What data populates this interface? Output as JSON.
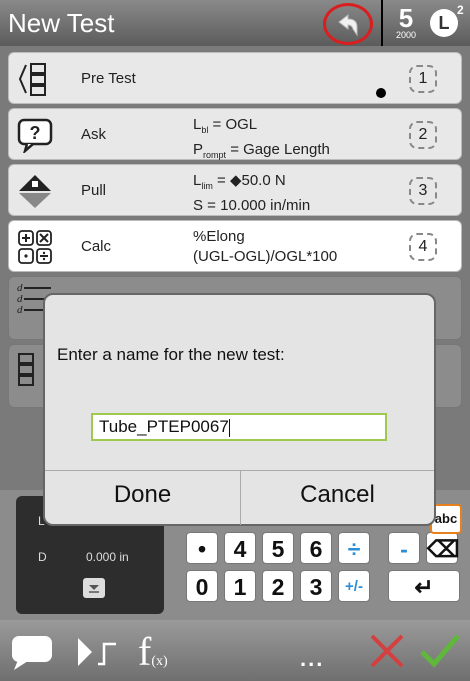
{
  "header": {
    "title": "New Test",
    "step_number": "5",
    "step_sub": "2000",
    "mode_letter": "L",
    "mode_sup": "2"
  },
  "steps": [
    {
      "name": "Pre Test",
      "line1": "",
      "line1_sub": "",
      "line1_rest": "",
      "line2": "",
      "line2_sub": "",
      "line2_rest": "",
      "number": "1",
      "icon": "pretest-icon"
    },
    {
      "name": "Ask",
      "line1": "L",
      "line1_sub": "bl",
      "line1_rest": " = OGL",
      "line2": "P",
      "line2_sub": "rompt",
      "line2_rest": " = Gage Length",
      "number": "2",
      "icon": "question-icon"
    },
    {
      "name": "Pull",
      "line1": "L",
      "line1_sub": "lim",
      "line1_rest": " = ◆50.0 N",
      "line2": "S = 10.000 in/min",
      "line2_sub": "",
      "line2_rest": "",
      "number": "3",
      "icon": "pull-icon"
    },
    {
      "name": "Calc",
      "line1": "%Elong",
      "line1_sub": "",
      "line1_rest": "",
      "line2": "(UGL-OGL)/OGL*100",
      "line2_sub": "",
      "line2_rest": "",
      "number": "4",
      "icon": "calc-icon"
    }
  ],
  "panel": {
    "label_l": "L",
    "label_d": "D",
    "value_d": "0.000 in"
  },
  "keypad": {
    "k_dot": "•",
    "k4": "4",
    "k5": "5",
    "k6": "6",
    "k_div": "÷",
    "k_minus": "-",
    "k0": "0",
    "k1": "1",
    "k2": "2",
    "k3": "3",
    "k_pm": "+/-",
    "k_abc": "abc",
    "k_back": "⌫",
    "k_enter": "↵"
  },
  "footer": {
    "func_label": "f",
    "func_sub": "(x)",
    "dots": "..."
  },
  "dialog": {
    "prompt": "Enter a name for the new test:",
    "value": "Tube_PTEP0067",
    "done": "Done",
    "cancel": "Cancel"
  }
}
